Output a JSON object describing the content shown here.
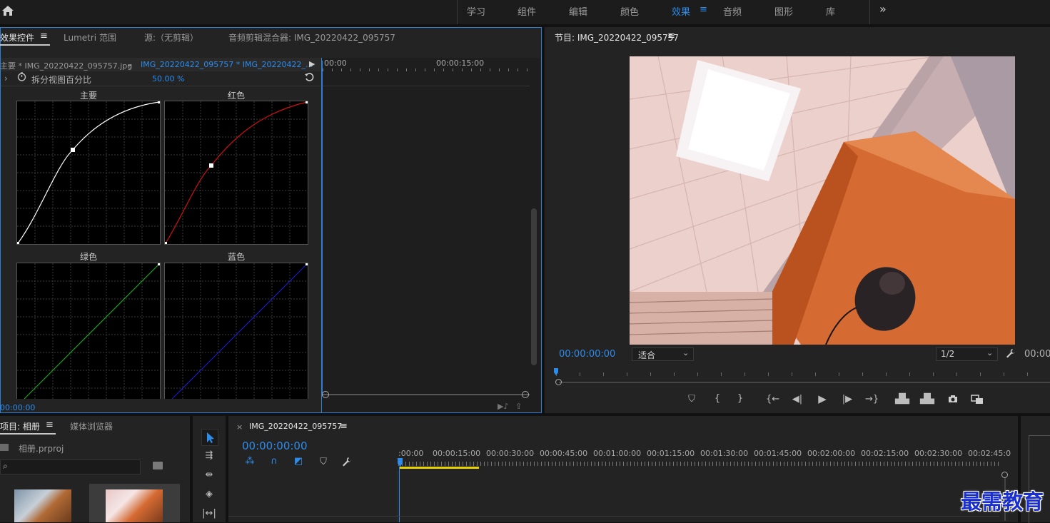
{
  "workspaces": [
    {
      "label": "学习",
      "active": false
    },
    {
      "label": "组件",
      "active": false
    },
    {
      "label": "编辑",
      "active": false
    },
    {
      "label": "颜色",
      "active": false
    },
    {
      "label": "效果",
      "active": true
    },
    {
      "label": "音频",
      "active": false
    },
    {
      "label": "图形",
      "active": false
    },
    {
      "label": "库",
      "active": false
    }
  ],
  "workspace_menu_glyph": "≡",
  "more_glyph": "»",
  "effect_panel": {
    "tabs": [
      {
        "label": "效果控件",
        "active": true
      },
      {
        "label": "Lumetri 范围",
        "active": false
      },
      {
        "label": "源:（无剪辑）",
        "active": false
      },
      {
        "label": "音频剪辑混合器: IMG_20220422_095757",
        "active": false
      }
    ],
    "master_clip": "主要 * IMG_20220422_095757.jpg",
    "sequence_clip": "IMG_20220422_095757 * IMG_20220422_...",
    "split_label": "拆分视图百分比",
    "split_value": "50.00 %",
    "curves": [
      {
        "title": "主要",
        "color": "#ffffff"
      },
      {
        "title": "红色",
        "color": "#d01010"
      },
      {
        "title": "绿色",
        "color": "#1fa01f"
      },
      {
        "title": "蓝色",
        "color": "#1a1ac0"
      }
    ],
    "timecode": "00:00:00",
    "ruler_start": "00:00",
    "ruler_mid": "00:00:15:00"
  },
  "program_monitor": {
    "title": "节目: IMG_20220422_095757",
    "timecode": "00:00:00:00",
    "fit_option": "适合",
    "resolution": "1/2",
    "timecode_right": "00:00"
  },
  "project_panel": {
    "tabs": [
      {
        "label": "项目: 相册",
        "active": true
      },
      {
        "label": "媒体浏览器",
        "active": false
      }
    ],
    "project_file": "相册.prproj",
    "search_placeholder": ""
  },
  "timeline": {
    "sequence": "IMG_20220422_095757",
    "timecode": "00:00:00:00",
    "ruler": [
      ":00:00",
      "00:00:15:00",
      "00:00:30:00",
      "00:00:45:00",
      "00:01:00:00",
      "00:01:15:00",
      "00:01:30:00",
      "00:01:45:00",
      "00:02:00:00",
      "00:02:15:00",
      "00:02:30:00",
      "00:02:45:0"
    ]
  },
  "watermark": "最需教育"
}
